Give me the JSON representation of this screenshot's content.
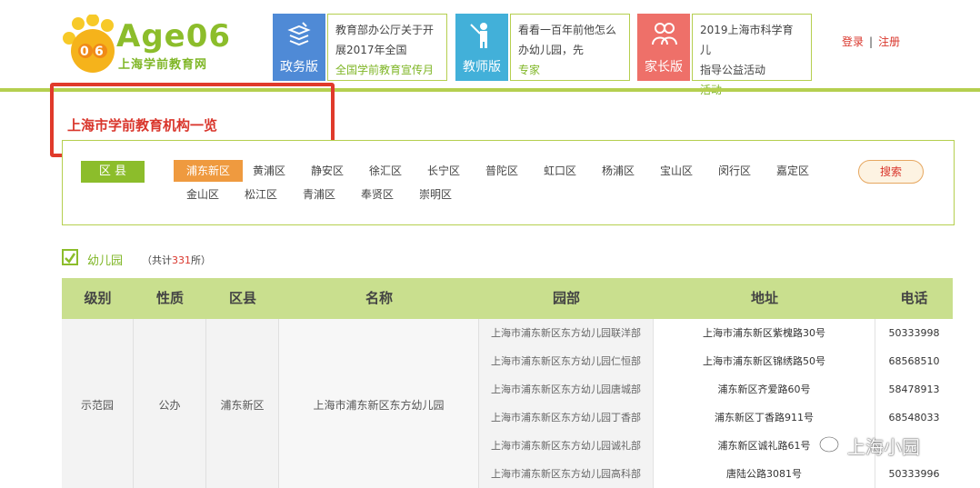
{
  "header": {
    "logo_text": "Age06",
    "logo_sub": "上海学前教育网",
    "versions": [
      {
        "label": "政务版",
        "color": "#4f8ad6",
        "lines": [
          "教育部办公厅关于开",
          "展2017年全国"
        ],
        "tag": "学前教育宣传月",
        "tag_prefix": "全国"
      },
      {
        "label": "教师版",
        "color": "#42b0d9",
        "lines": [
          "看看一百年前他怎么",
          "办幼儿园，先"
        ],
        "tag": "专家",
        "tag_prefix": ""
      },
      {
        "label": "家长版",
        "color": "#ee7069",
        "lines": [
          "2019上海市科学育儿",
          "指导公益活动"
        ],
        "tag": "活动",
        "tag_prefix": ""
      }
    ],
    "login": "登录",
    "register": "注册"
  },
  "page": {
    "title": "上海市学前教育机构一览"
  },
  "filter": {
    "label": "区 县",
    "districts_row1": [
      "浦东新区",
      "黄浦区",
      "静安区",
      "徐汇区",
      "长宁区",
      "普陀区",
      "虹口区",
      "杨浦区",
      "宝山区",
      "闵行区",
      "嘉定区"
    ],
    "districts_row2": [
      "金山区",
      "松江区",
      "青浦区",
      "奉贤区",
      "崇明区"
    ],
    "selected": "浦东新区",
    "search": "搜索"
  },
  "section": {
    "label": "幼儿园",
    "count_prefix": "（共计",
    "count": "331",
    "count_suffix": "所）"
  },
  "table": {
    "headers": [
      "级别",
      "性质",
      "区县",
      "名称",
      "园部",
      "地址",
      "电话"
    ],
    "level": "示范园",
    "nature": "公办",
    "district": "浦东新区",
    "name": "上海市浦东新区东方幼儿园",
    "rows": [
      {
        "campus": "上海市浦东新区东方幼儿园联洋部",
        "address": "上海市浦东新区紫槐路30号",
        "phone": "50333998"
      },
      {
        "campus": "上海市浦东新区东方幼儿园仁恒部",
        "address": "上海市浦东新区锦绣路50号",
        "phone": "68568510"
      },
      {
        "campus": "上海市浦东新区东方幼儿园唐城部",
        "address": "浦东新区齐爱路60号",
        "phone": "58478913"
      },
      {
        "campus": "上海市浦东新区东方幼儿园丁香部",
        "address": "浦东新区丁香路911号",
        "phone": "68548033"
      },
      {
        "campus": "上海市浦东新区东方幼儿园诚礼部",
        "address": "浦东新区诚礼路61号",
        "phone": ""
      },
      {
        "campus": "上海市浦东新区东方幼儿园高科部",
        "address": "唐陆公路3081号",
        "phone": "50333996"
      }
    ]
  },
  "watermark": "上海小园",
  "colors": {
    "accent_green": "#8cbd2b",
    "accent_red": "#d9352b",
    "active_orange": "#ef9a3f"
  }
}
